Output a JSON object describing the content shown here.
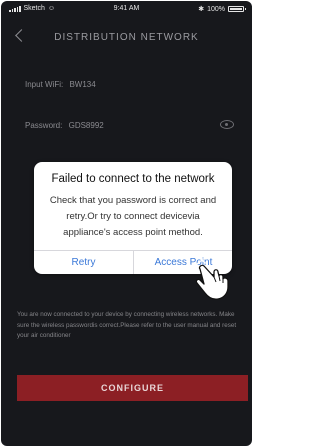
{
  "status_bar": {
    "carrier": "Sketch",
    "time": "9:41 AM",
    "battery": "100%",
    "battery_level": 1.0
  },
  "nav": {
    "title": "DISTRIBUTION NETWORK"
  },
  "form": {
    "wifi_label": "Input WiFi:",
    "wifi_value": "BW134",
    "password_label": "Password:",
    "password_value": "GDS8992"
  },
  "dialog": {
    "title": "Failed to connect to the network",
    "message": "Check that you password is correct and retry.Or try to connect devicevia appliance's access point method.",
    "retry_label": "Retry",
    "access_point_label": "Access Point"
  },
  "info_text": "You are now connected to your device by connecting wireless networks. Make sure the wireless passwordis correct.Please refer to the user manual and reset your air conditioner",
  "configure_label": "CONFIGURE",
  "colors": {
    "background": "#17181c",
    "accent": "#8c1f24",
    "link": "#3a78d8"
  }
}
